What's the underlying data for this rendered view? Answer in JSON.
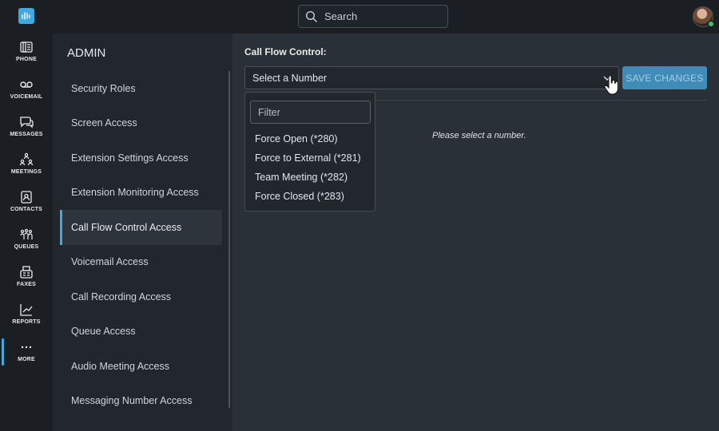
{
  "search": {
    "placeholder": "Search"
  },
  "rail": {
    "items": [
      {
        "label": "PHONE",
        "icon": "phone-icon"
      },
      {
        "label": "VOICEMAIL",
        "icon": "voicemail-icon"
      },
      {
        "label": "MESSAGES",
        "icon": "messages-icon"
      },
      {
        "label": "MEETINGS",
        "icon": "meetings-icon"
      },
      {
        "label": "CONTACTS",
        "icon": "contacts-icon"
      },
      {
        "label": "QUEUES",
        "icon": "queues-icon"
      },
      {
        "label": "FAXES",
        "icon": "fax-icon"
      },
      {
        "label": "REPORTS",
        "icon": "reports-icon"
      },
      {
        "label": "MORE",
        "icon": "more-icon"
      }
    ],
    "active": "MORE"
  },
  "admin": {
    "heading": "ADMIN",
    "items": [
      "Security Roles",
      "Screen Access",
      "Extension Settings Access",
      "Extension Monitoring Access",
      "Call Flow Control Access",
      "Voicemail Access",
      "Call Recording Access",
      "Queue Access",
      "Audio Meeting Access",
      "Messaging Number Access"
    ],
    "active_index": 4
  },
  "main": {
    "title": "Call Flow Control:",
    "select_value": "Select a Number",
    "save_label": "SAVE CHANGES",
    "empty_message": "Please select a number.",
    "dropdown": {
      "filter_placeholder": "Filter",
      "options": [
        "Force Open (*280)",
        "Force to External (*281)",
        "Team Meeting (*282)",
        "Force Closed (*283)"
      ]
    }
  },
  "colors": {
    "accent": "#3fa9e0",
    "save_button": "#3d8db8",
    "online_status": "#36c46a"
  }
}
